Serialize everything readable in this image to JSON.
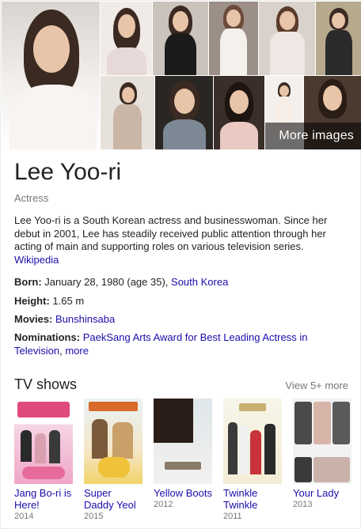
{
  "images": {
    "more_label": "More images"
  },
  "entity": {
    "name": "Lee Yoo-ri",
    "type": "Actress",
    "description": "Lee Yoo-ri is a South Korean actress and businesswoman. Since her debut in 2001, Lee has steadily received public attention through her acting of main and supporting roles on various television series.",
    "source_link": "Wikipedia"
  },
  "facts": {
    "born_label": "Born:",
    "born_value": "January 28, 1980 (age 35),",
    "born_place": "South Korea",
    "height_label": "Height:",
    "height_value": "1.65 m",
    "movies_label": "Movies:",
    "movies_value": "Bunshinsaba",
    "nominations_label": "Nominations:",
    "nominations_value": "PaekSang Arts Award for Best Leading Actress in Television",
    "nominations_more": "more"
  },
  "tv_shows": {
    "title": "TV shows",
    "view_more": "View 5+ more",
    "items": [
      {
        "name": "Jang Bo-ri is Here!",
        "year": "2014"
      },
      {
        "name": "Super Daddy Yeol",
        "year": "2015"
      },
      {
        "name": "Yellow Boots",
        "year": "2012"
      },
      {
        "name": "Twinkle Twinkle",
        "year": "2011"
      },
      {
        "name": "Your Lady",
        "year": "2013"
      }
    ]
  }
}
